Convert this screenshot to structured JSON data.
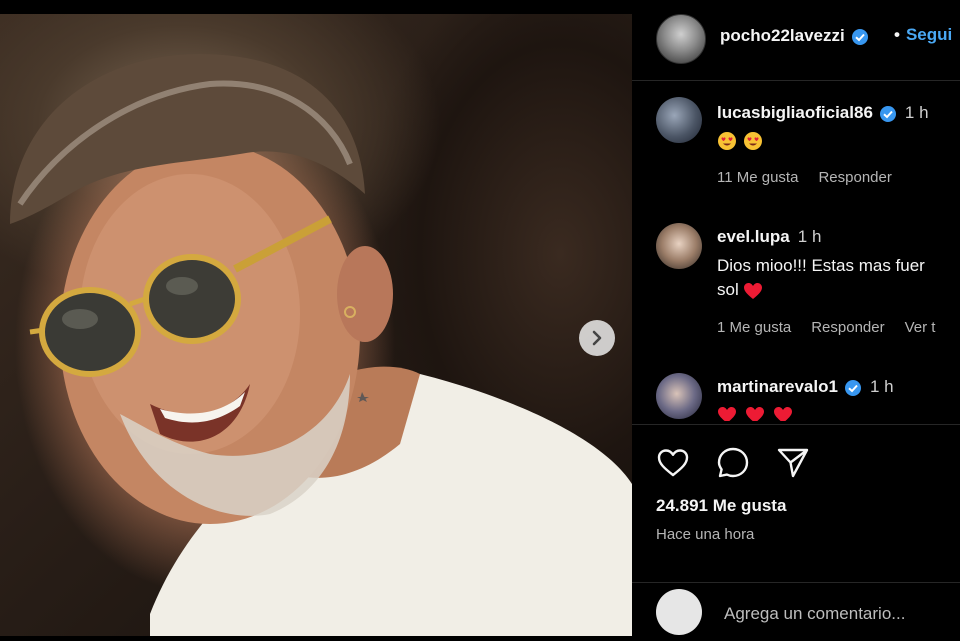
{
  "post": {
    "username": "pocho22lavezzi",
    "follow_label": "Segui",
    "follow_separator": "•"
  },
  "comments": [
    {
      "user": "lucasbigliaoficial86",
      "time": "1 h",
      "text": "",
      "emoji": [
        "heart-eyes",
        "heart-eyes"
      ],
      "likes": "11 Me gusta",
      "reply": "Responder",
      "extra": ""
    },
    {
      "user": "evel.lupa",
      "time": "1 h",
      "text": "Dios mioo!!! Estas mas fuer",
      "text2": "sol",
      "likes": "1 Me gusta",
      "reply": "Responder",
      "extra": "Ver t"
    },
    {
      "user": "martinarevalo1",
      "time": "1 h",
      "emoji": [
        "red-heart",
        "red-heart",
        "red-heart"
      ]
    }
  ],
  "stats": {
    "likes": "24.891 Me gusta",
    "posted": "Hace una hora"
  },
  "add_comment": {
    "placeholder": "Agrega un comentario..."
  },
  "colors": {
    "background": "#000000",
    "accent": "#4aa8f3",
    "verified": "#3897f0",
    "heart": "#ed1b34"
  },
  "icons": [
    "verified-icon",
    "chevron-right-icon",
    "heart-icon",
    "comment-icon",
    "share-icon",
    "heart-eyes-emoji",
    "red-heart-emoji"
  ]
}
